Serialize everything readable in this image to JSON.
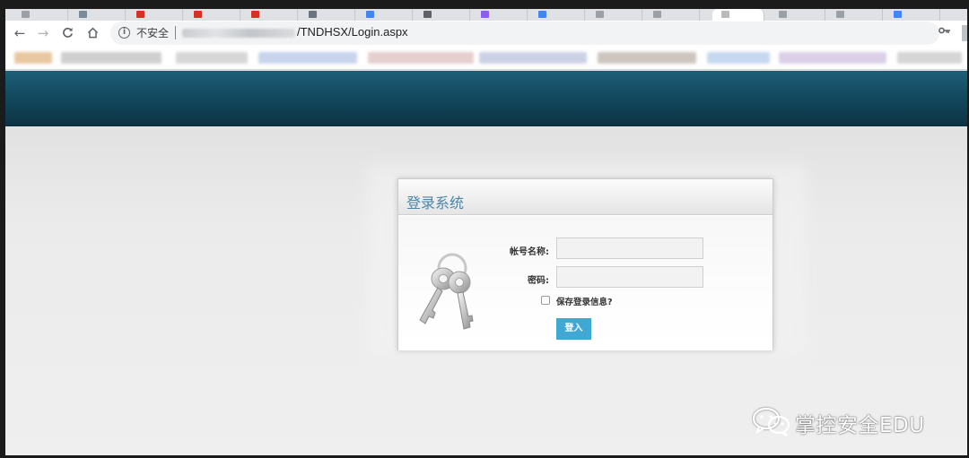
{
  "browser": {
    "security_label": "不安全",
    "url_path": "/TNDHSX/Login.aspx",
    "info_icon": "info-icon",
    "key_icon": "key-icon"
  },
  "nav": {
    "back": "←",
    "forward": "→",
    "reload": "C",
    "home": "⌂"
  },
  "login": {
    "title": "登录系统",
    "username_label": "帐号名称:",
    "password_label": "密码:",
    "username_value": "",
    "password_value": "",
    "remember_label": "保存登录信息?",
    "remember_checked": false,
    "submit_label": "登入"
  },
  "colors": {
    "header_band": "#134a60",
    "title_text": "#4a86a8",
    "button": "#3fa8d4"
  },
  "watermark": {
    "text": "掌控安全EDU",
    "icon": "wechat-icon"
  }
}
